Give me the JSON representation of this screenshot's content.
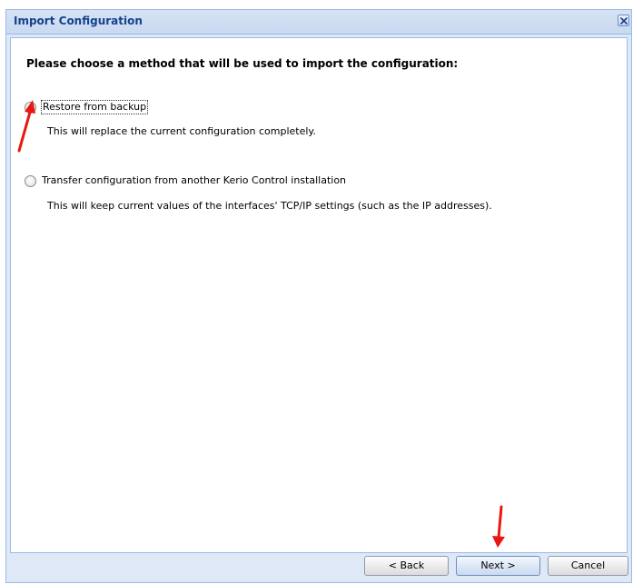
{
  "dialog": {
    "title": "Import Configuration",
    "close_icon": "close-icon"
  },
  "main": {
    "heading": "Please choose a method that will be used to import the configuration:",
    "options": [
      {
        "label": "Restore from backup",
        "description": "This will replace the current configuration completely.",
        "selected": true
      },
      {
        "label": "Transfer configuration from another Kerio Control installation",
        "description": "This will keep current values of the interfaces' TCP/IP settings (such as the IP addresses).",
        "selected": false
      }
    ]
  },
  "footer": {
    "back_label": "< Back",
    "next_label": "Next >",
    "cancel_label": "Cancel"
  },
  "annotations": {
    "arrow_color": "#e8170f"
  },
  "colors": {
    "title_text": "#15428b",
    "frame_border": "#99bbe8",
    "frame_background": "#dfe8f6"
  }
}
